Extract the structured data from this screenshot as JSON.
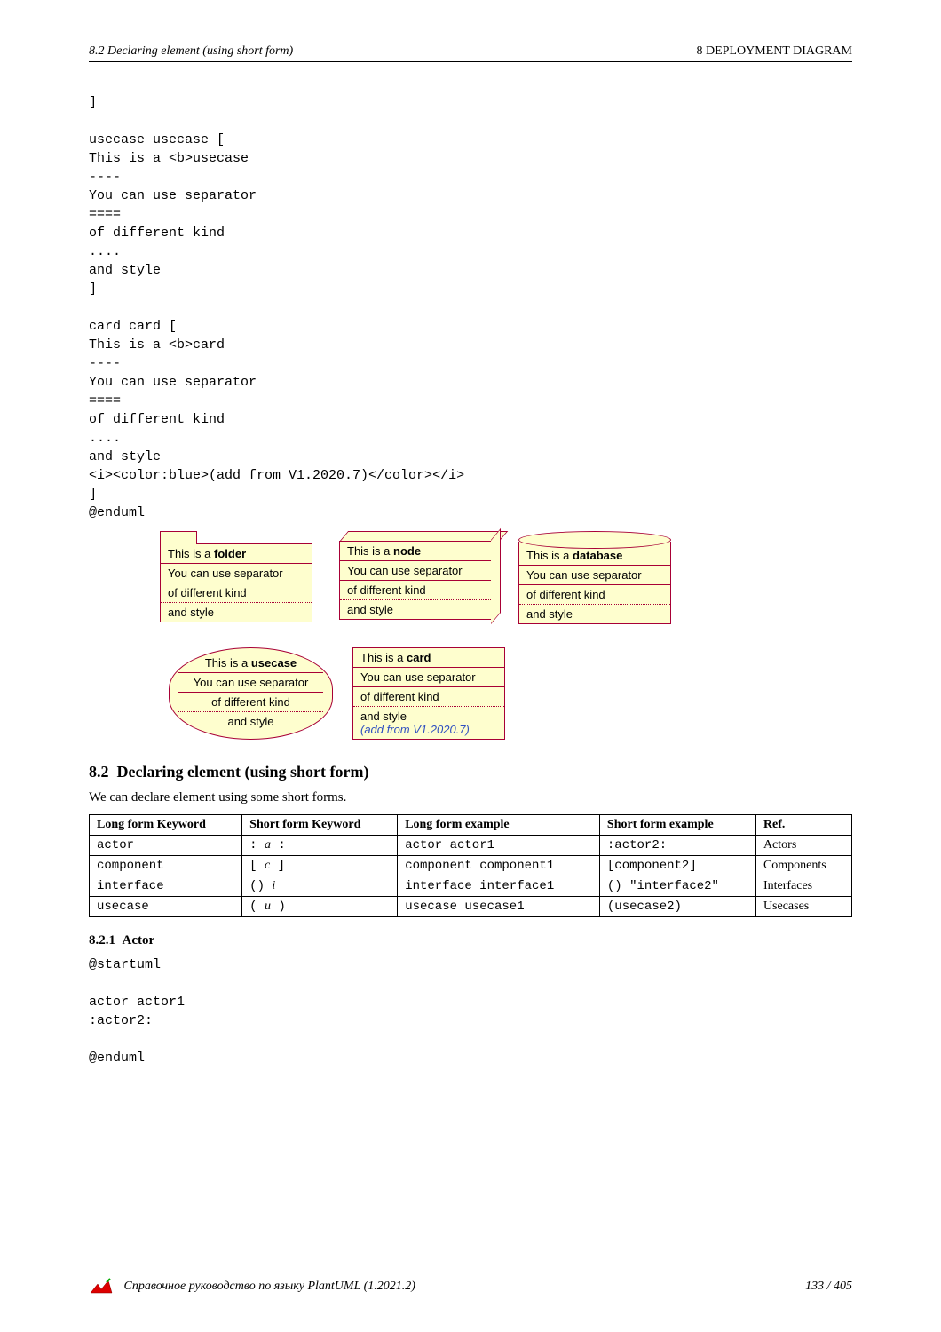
{
  "header": {
    "left": "8.2   Declaring element (using short form)",
    "right": "8   DEPLOYMENT DIAGRAM"
  },
  "code_block": "]\n\nusecase usecase [\nThis is a <b>usecase\n----\nYou can use separator\n====\nof different kind\n....\nand style\n]\n\ncard card [\nThis is a <b>card\n----\nYou can use separator\n====\nof different kind\n....\nand style\n<i><color:blue>(add from V1.2020.7)</color></i>\n]\n@enduml",
  "shapes": {
    "line1_prefix": "This is a ",
    "folder_bold": "folder",
    "node_bold": "node",
    "database_bold": "database",
    "usecase_bold": "usecase",
    "card_bold": "card",
    "line2": "You can use separator",
    "line3": "of different kind",
    "line4": "and style",
    "card_add": "(add from V1.2020.7)"
  },
  "section": {
    "num": "8.2",
    "title": "Declaring element (using short form)",
    "intro": "We can declare element using some short forms."
  },
  "table": {
    "headers": [
      "Long form Keyword",
      "Short form Keyword",
      "Long form example",
      "Short form example",
      "Ref."
    ],
    "rows": [
      {
        "lk": "actor",
        "sk_pre": ": ",
        "sk_it": "a",
        "sk_post": " :",
        "le": "actor actor1",
        "se": ":actor2:",
        "ref": "Actors"
      },
      {
        "lk": "component",
        "sk_pre": "[ ",
        "sk_it": "c",
        "sk_post": " ]",
        "le": "component component1",
        "se": "[component2]",
        "ref": "Components"
      },
      {
        "lk": "interface",
        "sk_pre": "() ",
        "sk_it": "i",
        "sk_post": "",
        "le": "interface interface1",
        "se": "() \"interface2\"",
        "ref": "Interfaces"
      },
      {
        "lk": "usecase",
        "sk_pre": "( ",
        "sk_it": "u",
        "sk_post": " )",
        "le": "usecase usecase1",
        "se": "(usecase2)",
        "ref": "Usecases"
      }
    ]
  },
  "subsection": {
    "num": "8.2.1",
    "title": "Actor",
    "code": "@startuml\n\nactor actor1\n:actor2:\n\n@enduml"
  },
  "footer": {
    "text": "Справочное руководство по языку PlantUML (1.2021.2)",
    "page": "133 / 405"
  }
}
